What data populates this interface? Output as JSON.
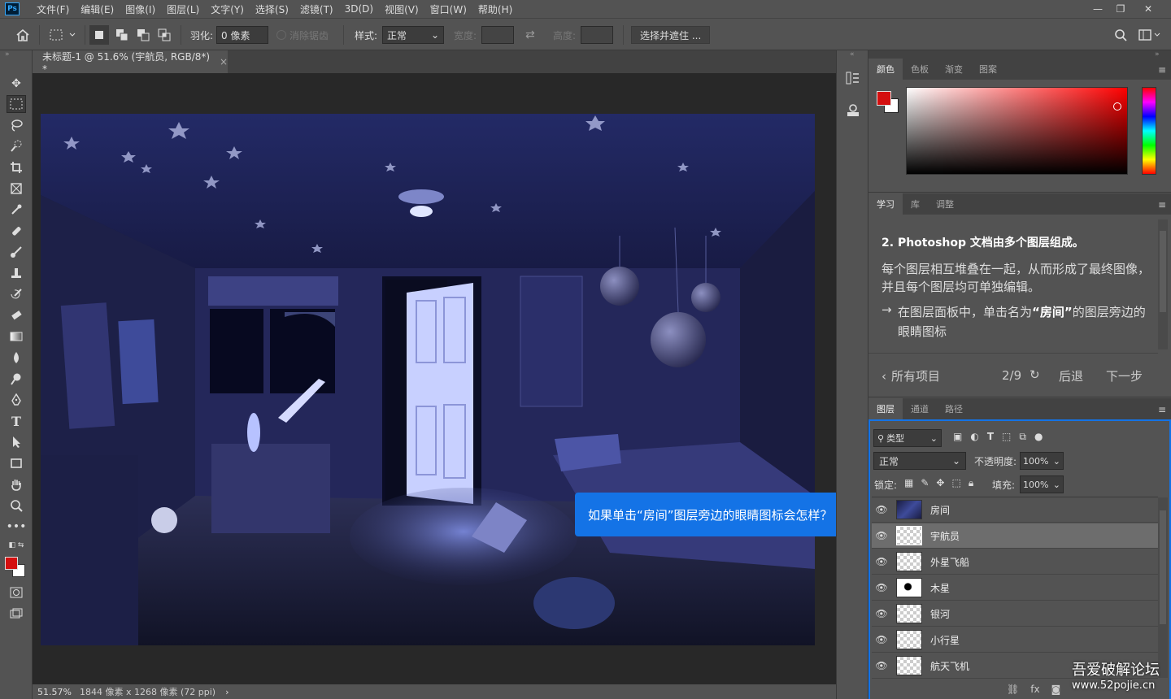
{
  "menubar": {
    "logo": "Ps",
    "items": [
      "文件(F)",
      "编辑(E)",
      "图像(I)",
      "图层(L)",
      "文字(Y)",
      "选择(S)",
      "滤镜(T)",
      "3D(D)",
      "视图(V)",
      "窗口(W)",
      "帮助(H)"
    ],
    "win_min": "—",
    "win_restore": "❐",
    "win_close": "✕"
  },
  "options": {
    "feather_label": "羽化:",
    "feather_value": "0 像素",
    "antialias_label": "消除锯齿",
    "style_label": "样式:",
    "style_value": "正常",
    "width_label": "宽度:",
    "height_label": "高度:",
    "select_mask_button": "选择并遮住 ..."
  },
  "document": {
    "tab_title": "未标题-1 @ 51.6% (宇航员, RGB/8*) *",
    "close_glyph": "×"
  },
  "status": {
    "zoom": "51.57%",
    "size": "1844 像素 x 1268 像素 (72 ppi)",
    "arrow": "›"
  },
  "color_panel": {
    "tabs": [
      "颜色",
      "色板",
      "渐变",
      "图案"
    ],
    "foreground": "#d40f0f",
    "background": "#ffffff"
  },
  "learn_panel": {
    "tabs": [
      "学习",
      "库",
      "调整"
    ],
    "step_number": "2.",
    "heading": "Photoshop 文档由多个图层组成。",
    "body": "每个图层相互堆叠在一起，从而形成了最终图像，并且每个图层均可单独编辑。",
    "instruction_pre": "在图层面板中，单击名为",
    "instruction_quote": "“房间”",
    "instruction_post": "的图层旁边的眼睛图标",
    "all_items": "所有项目",
    "progress": "2/9",
    "back": "后退",
    "next": "下一步"
  },
  "tooltip": "如果单击“房间”图层旁边的眼睛图标会怎样？",
  "layers_panel": {
    "tabs": [
      "图层",
      "通道",
      "路径"
    ],
    "filter_label": "类型",
    "blend_mode": "正常",
    "opacity_label": "不透明度:",
    "opacity_value": "100%",
    "lock_label": "锁定:",
    "fill_label": "填充:",
    "fill_value": "100%",
    "layers": [
      {
        "name": "房间",
        "selected": false
      },
      {
        "name": "宇航员",
        "selected": true
      },
      {
        "name": "外星飞船",
        "selected": false
      },
      {
        "name": "木星",
        "selected": false
      },
      {
        "name": "银河",
        "selected": false
      },
      {
        "name": "小行星",
        "selected": false
      },
      {
        "name": "航天飞机",
        "selected": false
      }
    ],
    "footer_fx": "fx"
  },
  "watermark": {
    "line1": "吾爱破解论坛",
    "line2": "www.52pojie.cn"
  }
}
